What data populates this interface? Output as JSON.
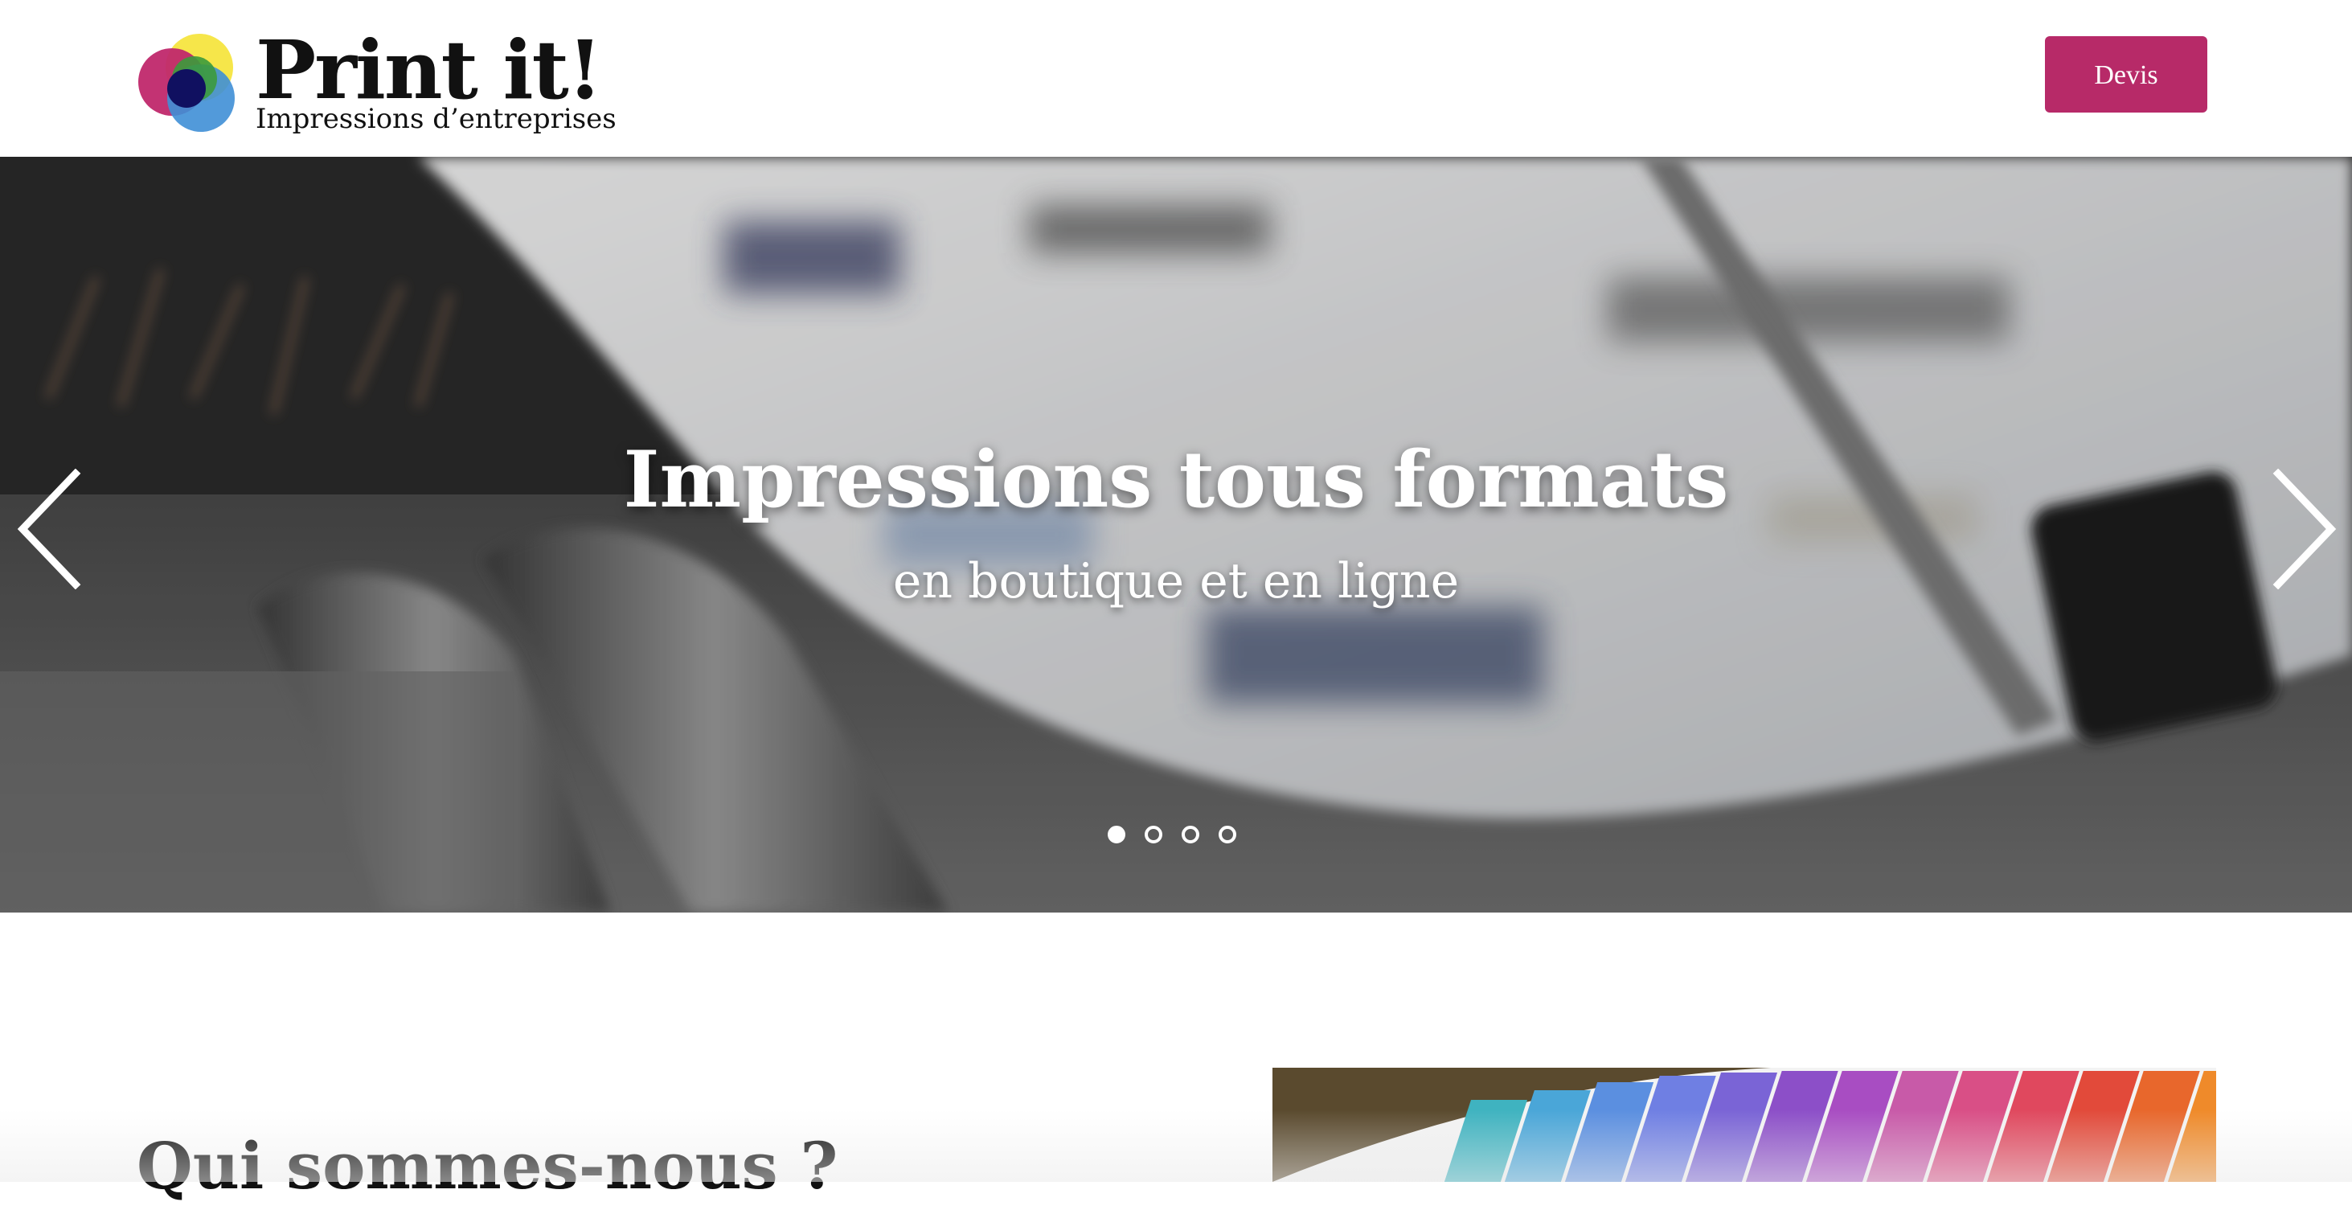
{
  "header": {
    "logo": {
      "title": "Print it!",
      "subtitle": "Impressions d’entreprises",
      "colors": [
        "#f6e64a",
        "#c0286b",
        "#3c9a3c",
        "#3f8fd6",
        "#101060"
      ]
    },
    "cta_label": "Devis",
    "cta_color": "#b72a68"
  },
  "hero": {
    "title": "Impressions tous formats",
    "subtitle": "en boutique et en ligne",
    "prev_icon": "chevron-left-icon",
    "next_icon": "chevron-right-icon",
    "slide_count": 4,
    "active_slide": 1
  },
  "about": {
    "heading": "Qui sommes-nous ?"
  }
}
